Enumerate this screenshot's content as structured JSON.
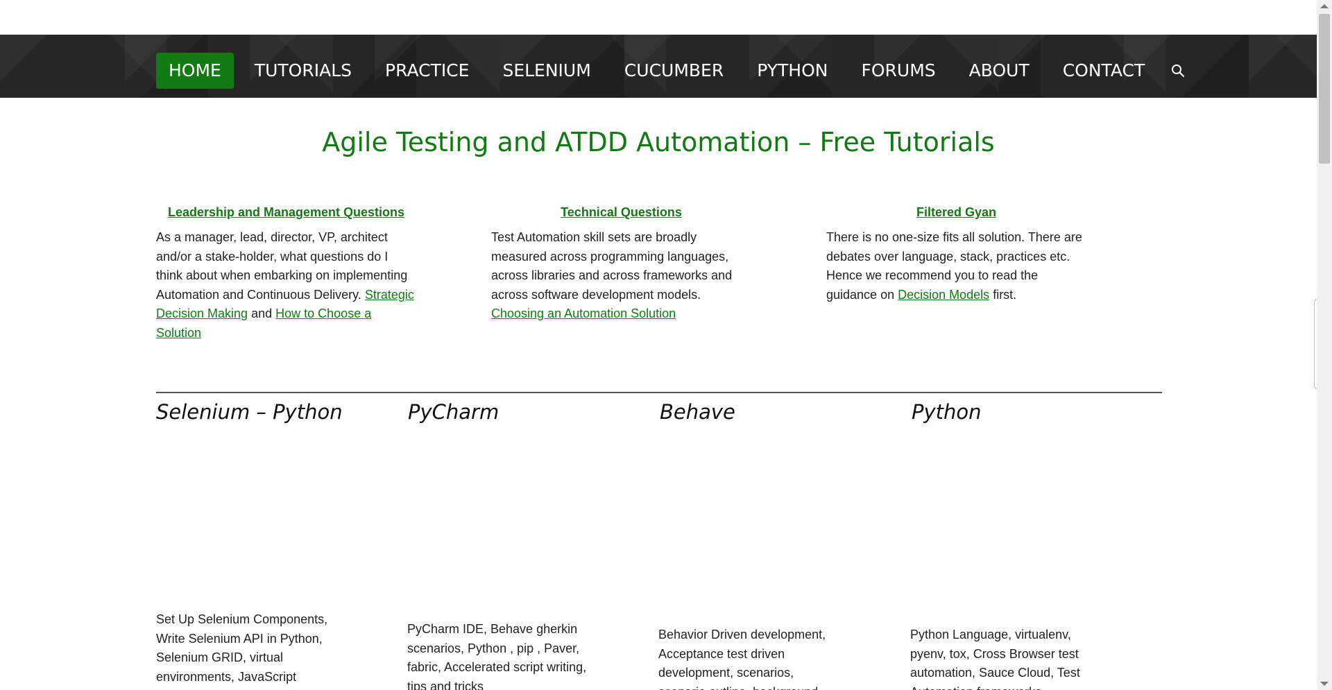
{
  "nav": {
    "items": [
      "HOME",
      "TUTORIALS",
      "PRACTICE",
      "SELENIUM",
      "CUCUMBER",
      "PYTHON",
      "FORUMS",
      "ABOUT",
      "CONTACT"
    ],
    "active": "HOME",
    "search_icon": "search-icon"
  },
  "headline": "Agile Testing and ATDD Automation –  Free Tutorials",
  "intro": [
    {
      "title": "Leadership and Management Questions",
      "text": "As a manager, lead, director, VP, architect and/or a stake-holder, what questions do I think about when embarking on implementing Automation and Continuous Delivery.",
      "link1": "Strategic Decision Making",
      "joiner": "and",
      "link2": "How to Choose a Solution"
    },
    {
      "title": "Technical Questions",
      "text": "Test Automation skill sets are broadly measured across programming languages, across libraries and across frameworks and across software development models.",
      "link1": "Choosing an Automation Solution"
    },
    {
      "title": "Filtered Gyan",
      "text": "There is no one-size fits all solution. There are debates over language, stack, practices etc. Hence we recommend you to read the guidance on",
      "link1": "Decision Models",
      "suffix": "first."
    }
  ],
  "topics": [
    {
      "title": "Selenium – Python",
      "desc": "Set Up Selenium Components, Write Selenium API in Python, Selenium GRID, virtual environments, JavaScript"
    },
    {
      "title": "PyCharm",
      "desc": "PyCharm IDE, Behave gherkin scenarios, Python , pip , Paver, fabric, Accelerated script writing, tips and tricks"
    },
    {
      "title": "Behave",
      "desc": "Behavior Driven development, Acceptance test driven development, scenarios, scenario outline, background"
    },
    {
      "title": "Python",
      "desc": "Python Language, virtualenv, pyenv, tox, Cross Browser test automation, Sauce Cloud, Test Automation frameworks"
    }
  ],
  "colors": {
    "accent": "#117a11",
    "nav_bg": "#262626"
  }
}
